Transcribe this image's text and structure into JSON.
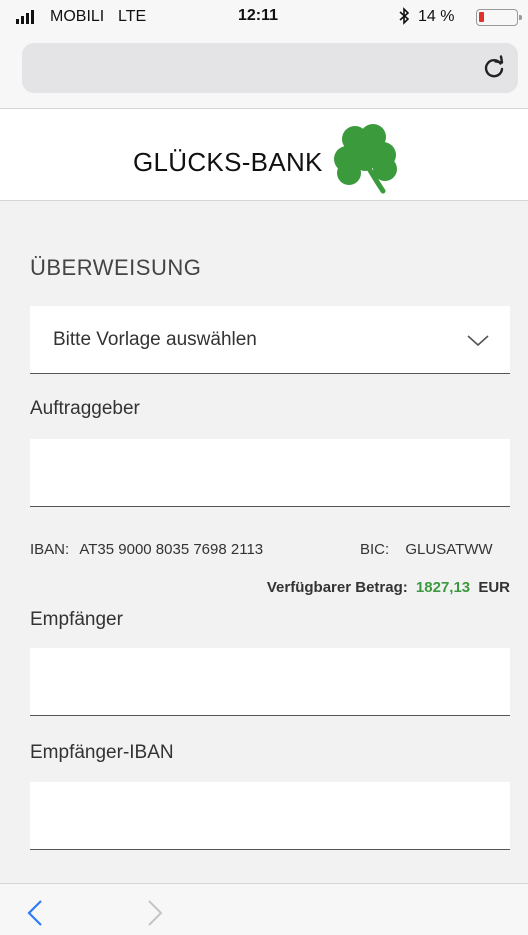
{
  "status_bar": {
    "carrier": "MOBILI",
    "network": "LTE",
    "time": "12:11",
    "bluetooth_icon": "bluetooth-icon",
    "battery_percent": "14 %",
    "battery_level": 0.14,
    "battery_color": "#e0312b"
  },
  "browser": {
    "url": "",
    "reload_icon": "reload-icon"
  },
  "header": {
    "bank_name": "GLÜCKS-BANK",
    "logo_icon": "shamrock-icon",
    "logo_color": "#3a9a3c"
  },
  "form": {
    "title": "ÜBERWEISUNG",
    "template_select": {
      "value": "Bitte Vorlage auswählen"
    },
    "auftraggeber": {
      "label": "Auftraggeber",
      "value": ""
    },
    "account": {
      "iban_label": "IBAN:",
      "iban_value": "AT35 9000 8035 7698 2113",
      "bic_label": "BIC:",
      "bic_value": "GLUSATWW",
      "available_label": "Verfügbarer Betrag:",
      "available_amount": "1827,13",
      "available_currency": "EUR",
      "amount_color": "#3b9a3f"
    },
    "empfaenger": {
      "label": "Empfänger",
      "value": ""
    },
    "empfaenger_iban": {
      "label": "Empfänger-IBAN",
      "value": ""
    }
  },
  "bottom_nav": {
    "back_icon": "chevron-left-icon",
    "forward_icon": "chevron-right-icon"
  }
}
